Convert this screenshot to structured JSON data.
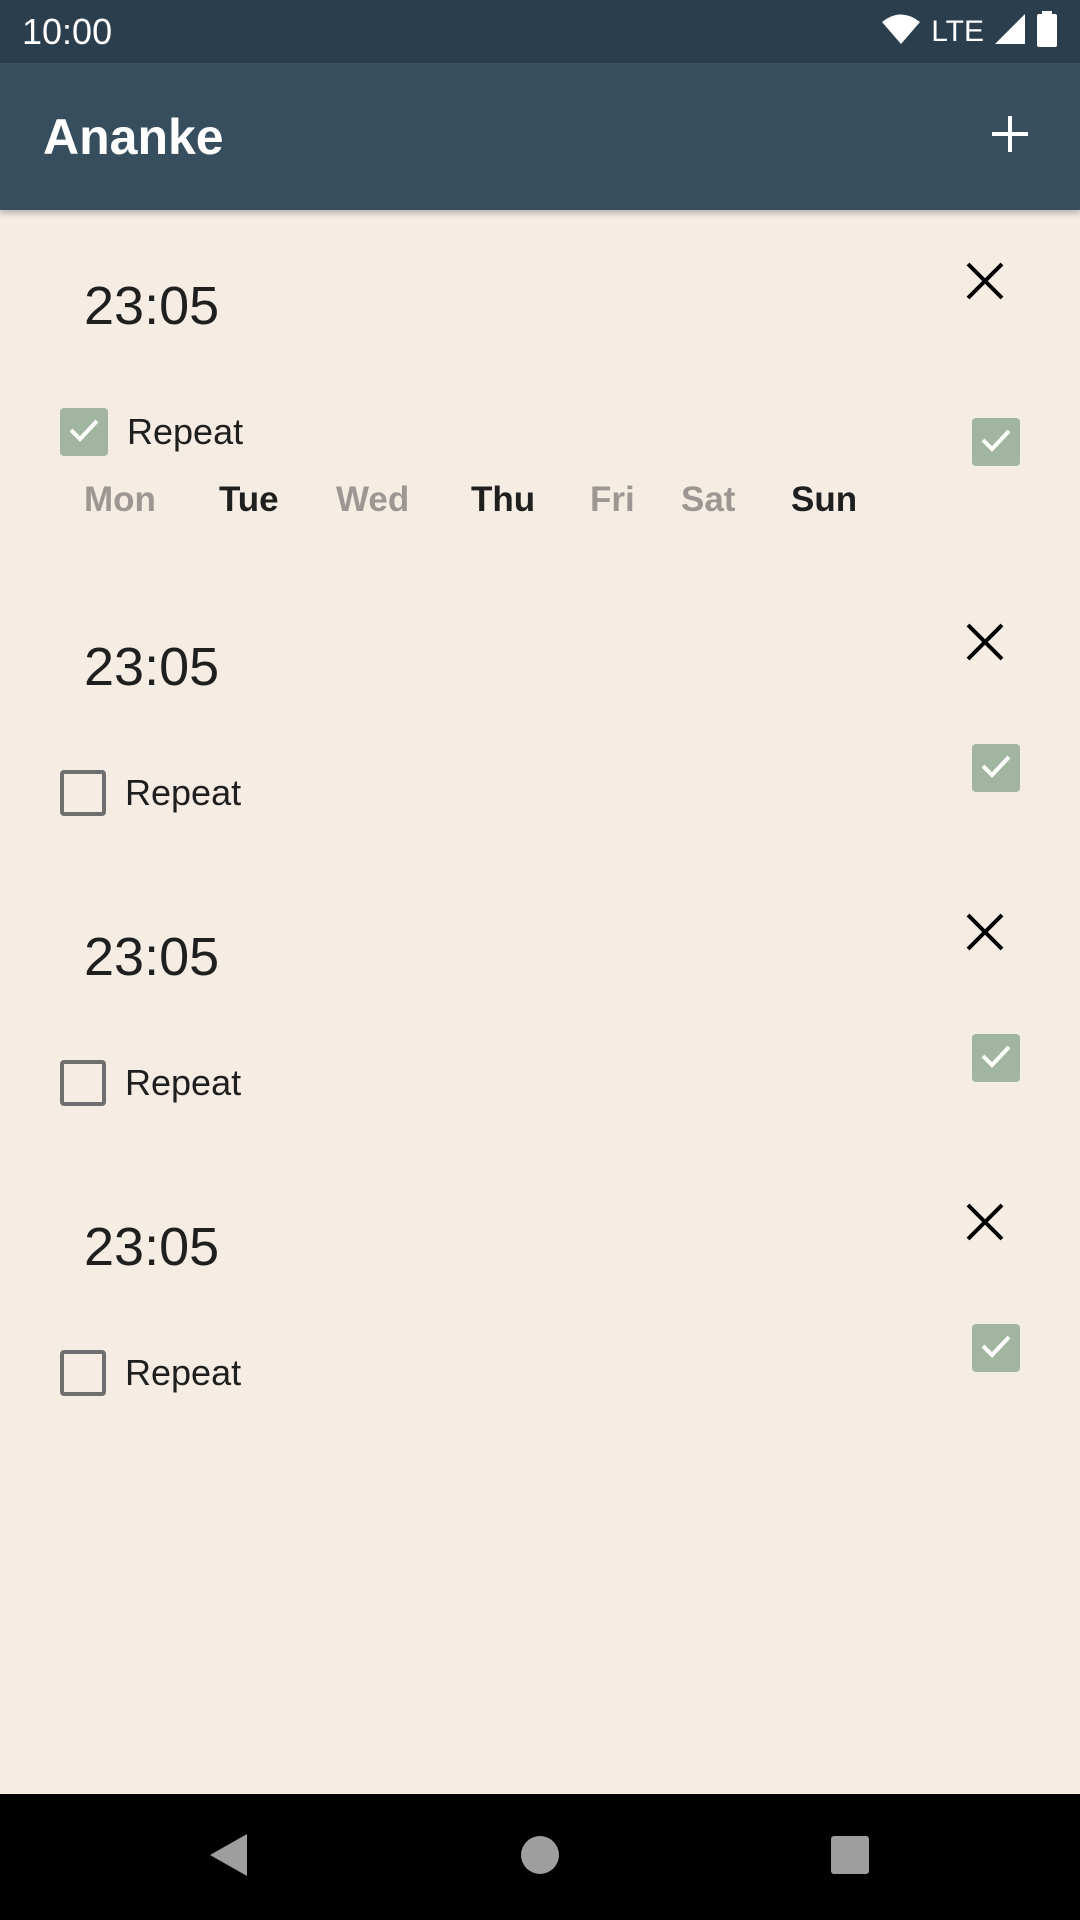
{
  "status_bar": {
    "time": "10:00",
    "network": "LTE"
  },
  "app_bar": {
    "title": "Ananke"
  },
  "alarms": [
    {
      "time": "23:05",
      "repeat_label": "Repeat",
      "repeat": true,
      "enabled": true,
      "days": [
        {
          "label": "Mon",
          "selected": false
        },
        {
          "label": "Tue",
          "selected": true
        },
        {
          "label": "Wed",
          "selected": false
        },
        {
          "label": "Thu",
          "selected": true
        },
        {
          "label": "Fri",
          "selected": false
        },
        {
          "label": "Sat",
          "selected": false
        },
        {
          "label": "Sun",
          "selected": true
        }
      ]
    },
    {
      "time": "23:05",
      "repeat_label": "Repeat",
      "repeat": false,
      "enabled": true
    },
    {
      "time": "23:05",
      "repeat_label": "Repeat",
      "repeat": false,
      "enabled": true
    },
    {
      "time": "23:05",
      "repeat_label": "Repeat",
      "repeat": false,
      "enabled": true
    }
  ],
  "colors": {
    "status_bar": "#2b3e4d",
    "app_bar": "#374e5e",
    "background": "#f5ece3",
    "check_accent": "#a2b5a0",
    "day_selected": "#1f1f1f",
    "day_unselected": "#9c9792"
  },
  "icons": {
    "add": "plus-icon",
    "delete": "close-icon",
    "check": "check-icon",
    "wifi": "wifi-icon",
    "signal": "signal-icon",
    "battery": "battery-icon",
    "back": "back-icon",
    "home": "home-icon",
    "recents": "recents-icon"
  }
}
